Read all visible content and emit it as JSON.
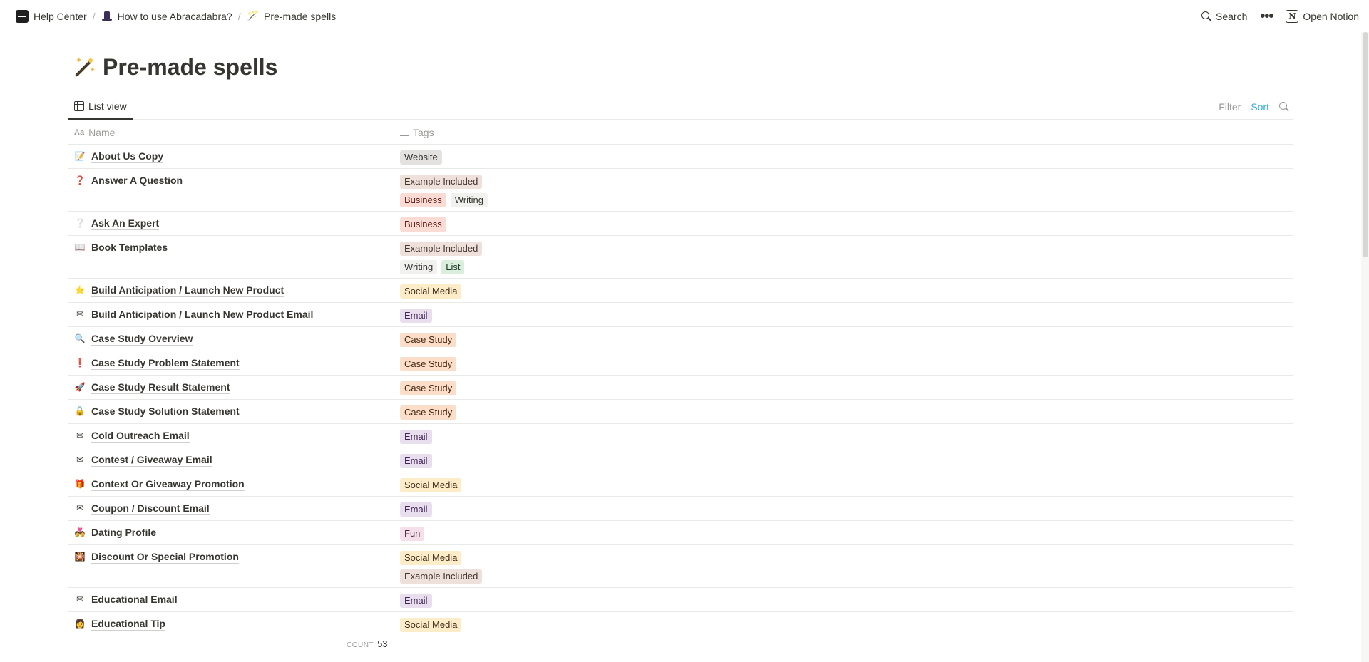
{
  "breadcrumbs": [
    {
      "label": "Help Center",
      "icon": "help-center-icon"
    },
    {
      "label": "How to use Abracadabra?",
      "icon": "wizard-hat-icon"
    },
    {
      "label": "Pre-made spells",
      "icon": "magic-wand-icon"
    }
  ],
  "topbar": {
    "search_label": "Search",
    "more_icon": "more-dots-icon",
    "open_notion_label": "Open Notion"
  },
  "page": {
    "title": "Pre-made spells",
    "icon": "magic-wand-icon"
  },
  "view": {
    "tab_label": "List view",
    "filter_label": "Filter",
    "sort_label": "Sort",
    "sort_color": "#2eaadc"
  },
  "columns": {
    "name": "Name",
    "tags": "Tags"
  },
  "tag_colors": {
    "Website": {
      "bg": "#e3e2e0",
      "fg": "#32302c"
    },
    "Example Included": {
      "bg": "#eee0da",
      "fg": "#44362d"
    },
    "Business": {
      "bg": "#fadcd4",
      "fg": "#5d1715"
    },
    "Writing": {
      "bg": "#f1f1ef",
      "fg": "#37352f"
    },
    "List": {
      "bg": "#dbeddb",
      "fg": "#1c3829"
    },
    "Social Media": {
      "bg": "#fdecc8",
      "fg": "#402c1b"
    },
    "Email": {
      "bg": "#e8deee",
      "fg": "#412454"
    },
    "Case Study": {
      "bg": "#fadec9",
      "fg": "#49290e"
    },
    "Fun": {
      "bg": "#f5e0e9",
      "fg": "#4c2337"
    }
  },
  "rows": [
    {
      "name": "About Us Copy",
      "icon": "memo",
      "glyph": "📝",
      "tags": [
        "Website"
      ]
    },
    {
      "name": "Answer A Question",
      "icon": "red-question-mark",
      "glyph": "❓",
      "tags": [
        "Example Included",
        "Business",
        "Writing"
      ]
    },
    {
      "name": "Ask An Expert",
      "icon": "white-question-mark",
      "glyph": "❔",
      "tags": [
        "Business"
      ]
    },
    {
      "name": "Book Templates",
      "icon": "open-book",
      "glyph": "📖",
      "tags": [
        "Example Included",
        "Writing",
        "List"
      ]
    },
    {
      "name": "Build Anticipation / Launch New Product",
      "icon": "star",
      "glyph": "⭐",
      "tags": [
        "Social Media"
      ]
    },
    {
      "name": "Build Anticipation / Launch New Product Email",
      "icon": "envelope",
      "glyph": "✉",
      "tags": [
        "Email"
      ]
    },
    {
      "name": "Case Study Overview",
      "icon": "magnifying-glass",
      "glyph": "🔍",
      "tags": [
        "Case Study"
      ]
    },
    {
      "name": "Case Study Problem Statement",
      "icon": "exclamation-mark",
      "glyph": "❗",
      "tags": [
        "Case Study"
      ]
    },
    {
      "name": "Case Study Result Statement",
      "icon": "rocket",
      "glyph": "🚀",
      "tags": [
        "Case Study"
      ]
    },
    {
      "name": "Case Study Solution Statement",
      "icon": "unlocked",
      "glyph": "🔓",
      "tags": [
        "Case Study"
      ]
    },
    {
      "name": "Cold Outreach Email",
      "icon": "envelope",
      "glyph": "✉",
      "tags": [
        "Email"
      ]
    },
    {
      "name": "Contest / Giveaway Email",
      "icon": "envelope",
      "glyph": "✉",
      "tags": [
        "Email"
      ]
    },
    {
      "name": "Context Or Giveaway Promotion",
      "icon": "gift",
      "glyph": "🎁",
      "tags": [
        "Social Media"
      ]
    },
    {
      "name": "Coupon / Discount Email",
      "icon": "envelope",
      "glyph": "✉",
      "tags": [
        "Email"
      ]
    },
    {
      "name": "Dating Profile",
      "icon": "couple-with-heart",
      "glyph": "💑",
      "tags": [
        "Fun"
      ]
    },
    {
      "name": "Discount Or Special Promotion",
      "icon": "sparkle-picture",
      "glyph": "🎇",
      "tags": [
        "Social Media",
        "Example Included"
      ]
    },
    {
      "name": "Educational Email",
      "icon": "envelope",
      "glyph": "✉",
      "tags": [
        "Email"
      ]
    },
    {
      "name": "Educational Tip",
      "icon": "teacher",
      "glyph": "👩",
      "tags": [
        "Social Media"
      ]
    }
  ],
  "footer": {
    "count_label": "COUNT",
    "count_value": "53"
  }
}
